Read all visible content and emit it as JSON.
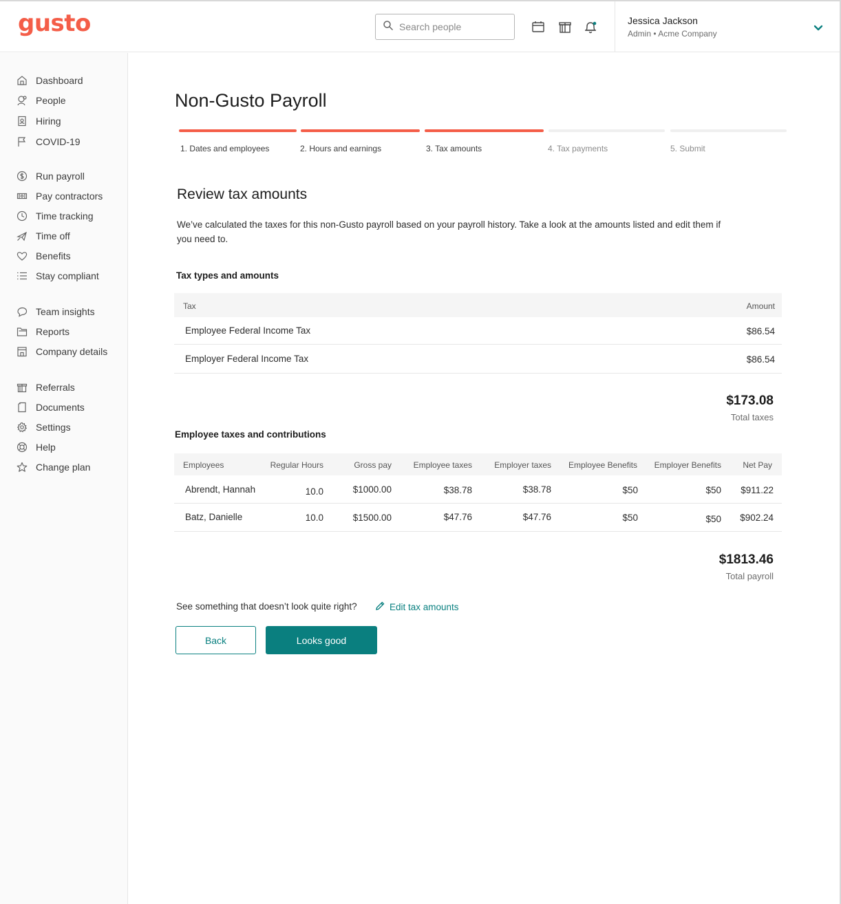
{
  "header": {
    "logo": "gusto",
    "search_placeholder": "Search people",
    "user_name": "Jessica Jackson",
    "user_sub": "Admin • Acme Company"
  },
  "sidebar": {
    "groups": [
      [
        {
          "label": "Dashboard",
          "icon": "home-icon"
        },
        {
          "label": "People",
          "icon": "people-icon"
        },
        {
          "label": "Hiring",
          "icon": "badge-icon"
        },
        {
          "label": "COVID-19",
          "icon": "flag-icon"
        }
      ],
      [
        {
          "label": "Run payroll",
          "icon": "dollar-icon"
        },
        {
          "label": "Pay contractors",
          "icon": "money-icon"
        },
        {
          "label": "Time tracking",
          "icon": "clock-icon"
        },
        {
          "label": "Time off",
          "icon": "plane-icon"
        },
        {
          "label": "Benefits",
          "icon": "heart-icon"
        },
        {
          "label": "Stay compliant",
          "icon": "list-icon"
        }
      ],
      [
        {
          "label": "Team insights",
          "icon": "chat-icon"
        },
        {
          "label": "Reports",
          "icon": "folder-icon"
        },
        {
          "label": "Company details",
          "icon": "building-icon"
        }
      ],
      [
        {
          "label": "Referrals",
          "icon": "gift-icon"
        },
        {
          "label": "Documents",
          "icon": "document-icon"
        },
        {
          "label": "Settings",
          "icon": "gear-icon"
        },
        {
          "label": "Help",
          "icon": "lifebuoy-icon"
        },
        {
          "label": "Change plan",
          "icon": "star-icon"
        }
      ]
    ]
  },
  "main": {
    "title": "Non-Gusto Payroll",
    "steps": [
      {
        "label": "1. Dates and employees",
        "done": true
      },
      {
        "label": "2. Hours and earnings",
        "done": true
      },
      {
        "label": "3. Tax amounts",
        "done": true
      },
      {
        "label": "4. Tax payments",
        "done": false
      },
      {
        "label": "5. Submit",
        "done": false
      }
    ],
    "section_title": "Review tax amounts",
    "section_desc": "We’ve calculated the taxes for this non-Gusto payroll based on your payroll history. Take a look at the amounts listed and edit them if you need to.",
    "tax_table": {
      "heading": "Tax types and amounts",
      "headers": [
        "Tax",
        "Amount"
      ],
      "rows": [
        [
          "Employee Federal Income Tax",
          "$86.54"
        ],
        [
          "Employer Federal Income Tax",
          "$86.54"
        ]
      ],
      "total_value": "$173.08",
      "total_label": "Total taxes"
    },
    "employee_table": {
      "heading": "Employee taxes and contributions",
      "headers": [
        "Employees",
        "Regular Hours",
        "Gross pay",
        "Employee taxes",
        "Employer taxes",
        "Employee Benefits",
        "Employer Benefits",
        "Net Pay"
      ],
      "rows": [
        [
          "Abrendt, Hannah",
          "10.0",
          "$1000.00",
          "$38.78",
          "$38.78",
          "$50",
          "$50",
          "$911.22"
        ],
        [
          "Batz, Danielle",
          "10.0",
          "$1500.00",
          "$47.76",
          "$47.76",
          "$50",
          "$50",
          "$902.24"
        ]
      ],
      "total_value": "$1813.46",
      "total_label": "Total payroll"
    },
    "question": "See something that doesn’t look quite right?",
    "edit_link": "Edit tax amounts",
    "back_label": "Back",
    "looks_good_label": "Looks good"
  },
  "colors": {
    "brand": "#f45d48",
    "accent": "#0a7f7f"
  }
}
